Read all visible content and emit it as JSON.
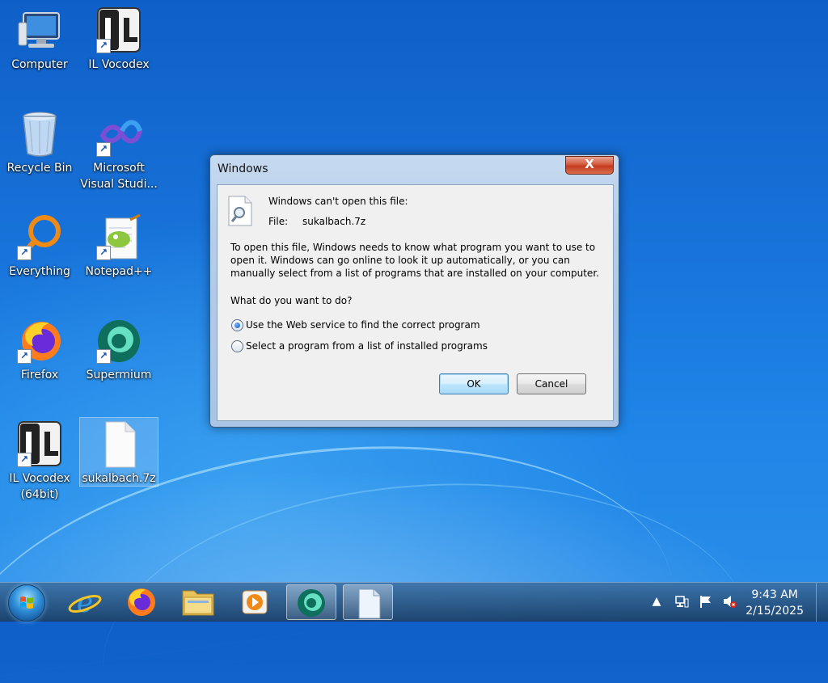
{
  "desktop": {
    "icons": [
      {
        "label": "Computer",
        "icon": "computer-icon"
      },
      {
        "label": "IL Vocodex",
        "icon": "il-vocodex-icon"
      },
      {
        "label": "Recycle Bin",
        "icon": "recycle-bin-icon"
      },
      {
        "label": "Microsoft Visual Studi...",
        "icon": "visual-studio-icon"
      },
      {
        "label": "Everything",
        "icon": "everything-search-icon"
      },
      {
        "label": "Notepad++",
        "icon": "notepad-plus-plus-icon"
      },
      {
        "label": "Firefox",
        "icon": "firefox-icon"
      },
      {
        "label": "Supermium",
        "icon": "supermium-icon"
      },
      {
        "label": "IL Vocodex (64bit)",
        "icon": "il-vocodex-icon"
      },
      {
        "label": "sukalbach.7z",
        "icon": "blank-file-icon"
      }
    ]
  },
  "dialog": {
    "title": "Windows",
    "close_label": "X",
    "heading": "Windows can't open this file:",
    "file_label": "File:",
    "file_name": "sukalbach.7z",
    "description_lines": [
      "To open this file, Windows needs to know what program you want to use to",
      "open it. Windows can go online to look it up automatically, or you can",
      "manually select from a list of programs that are installed on your computer."
    ],
    "question": "What do you want to do?",
    "options": [
      {
        "label": "Use the Web service to find the correct program",
        "checked": true
      },
      {
        "label": "Select a program from a list of installed programs",
        "checked": false
      }
    ],
    "ok_label": "OK",
    "cancel_label": "Cancel"
  },
  "taskbar": {
    "pinned": [
      "internet-explorer-icon",
      "firefox-icon",
      "file-explorer-icon",
      "media-player-icon",
      "supermium-icon",
      "blank-file-icon"
    ],
    "tray_icons": [
      "show-hidden-icons-icon",
      "network-icon",
      "action-center-flag-icon",
      "volume-muted-icon"
    ],
    "time": "9:43 AM",
    "date": "2/15/2025"
  },
  "colors": {
    "accent": "#1976dc",
    "close_button": "#c43a1e"
  }
}
